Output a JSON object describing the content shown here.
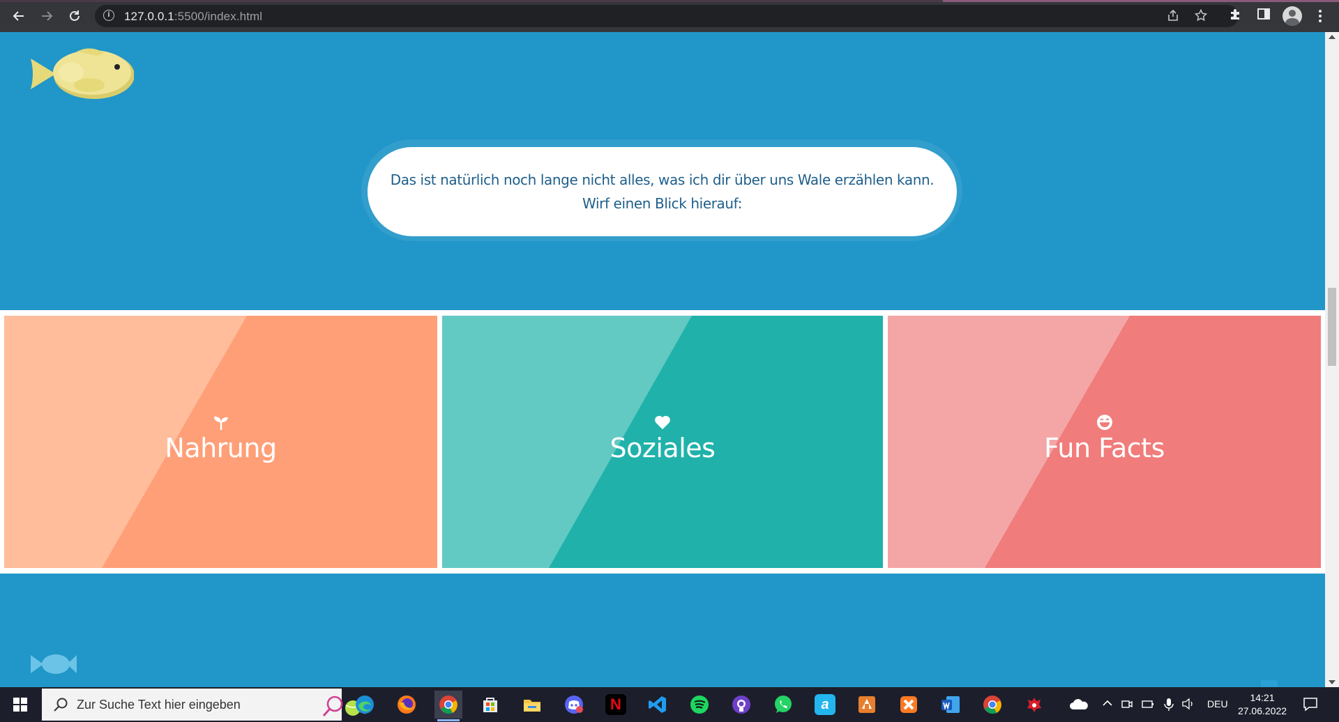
{
  "browser": {
    "back_label": "←",
    "forward_label": "→",
    "reload_label": "⟳",
    "info_label": "i",
    "url_host": "127.0.0.1",
    "url_rest": ":5500/index.html"
  },
  "page": {
    "bubble_line1": "Das ist natürlich noch lange nicht alles, was ich dir über uns Wale erzählen kann.",
    "bubble_line2": "Wirf einen Blick hierauf:",
    "cards": [
      {
        "label": "Nahrung",
        "icon": "seedling-icon",
        "light": "#ffbd9c",
        "dark": "#ff9f78"
      },
      {
        "label": "Soziales",
        "icon": "heart-icon",
        "light": "#63c9c3",
        "dark": "#20b2aa"
      },
      {
        "label": "Fun Facts",
        "icon": "laughing-face-icon",
        "light": "#f4a6a6",
        "dark": "#f07c7c"
      }
    ],
    "colors": {
      "background": "#2196c8",
      "bubble_text": "#1f5f8a",
      "fish": "#efe496"
    }
  },
  "taskbar": {
    "search_placeholder": "Zur Suche Text hier eingeben",
    "language": "DEU",
    "time": "14:21",
    "date": "27.06.2022",
    "apps": [
      "edge-icon",
      "firefox-icon",
      "chrome-icon",
      "store-icon",
      "file-explorer-icon",
      "discord-icon",
      "netflix-icon",
      "vscode-icon",
      "spotify-icon",
      "github-icon",
      "whatsapp-icon",
      "app-a-icon",
      "office-icon",
      "xampp-icon",
      "word-icon",
      "chrome-2-icon",
      "app-red-icon"
    ]
  }
}
